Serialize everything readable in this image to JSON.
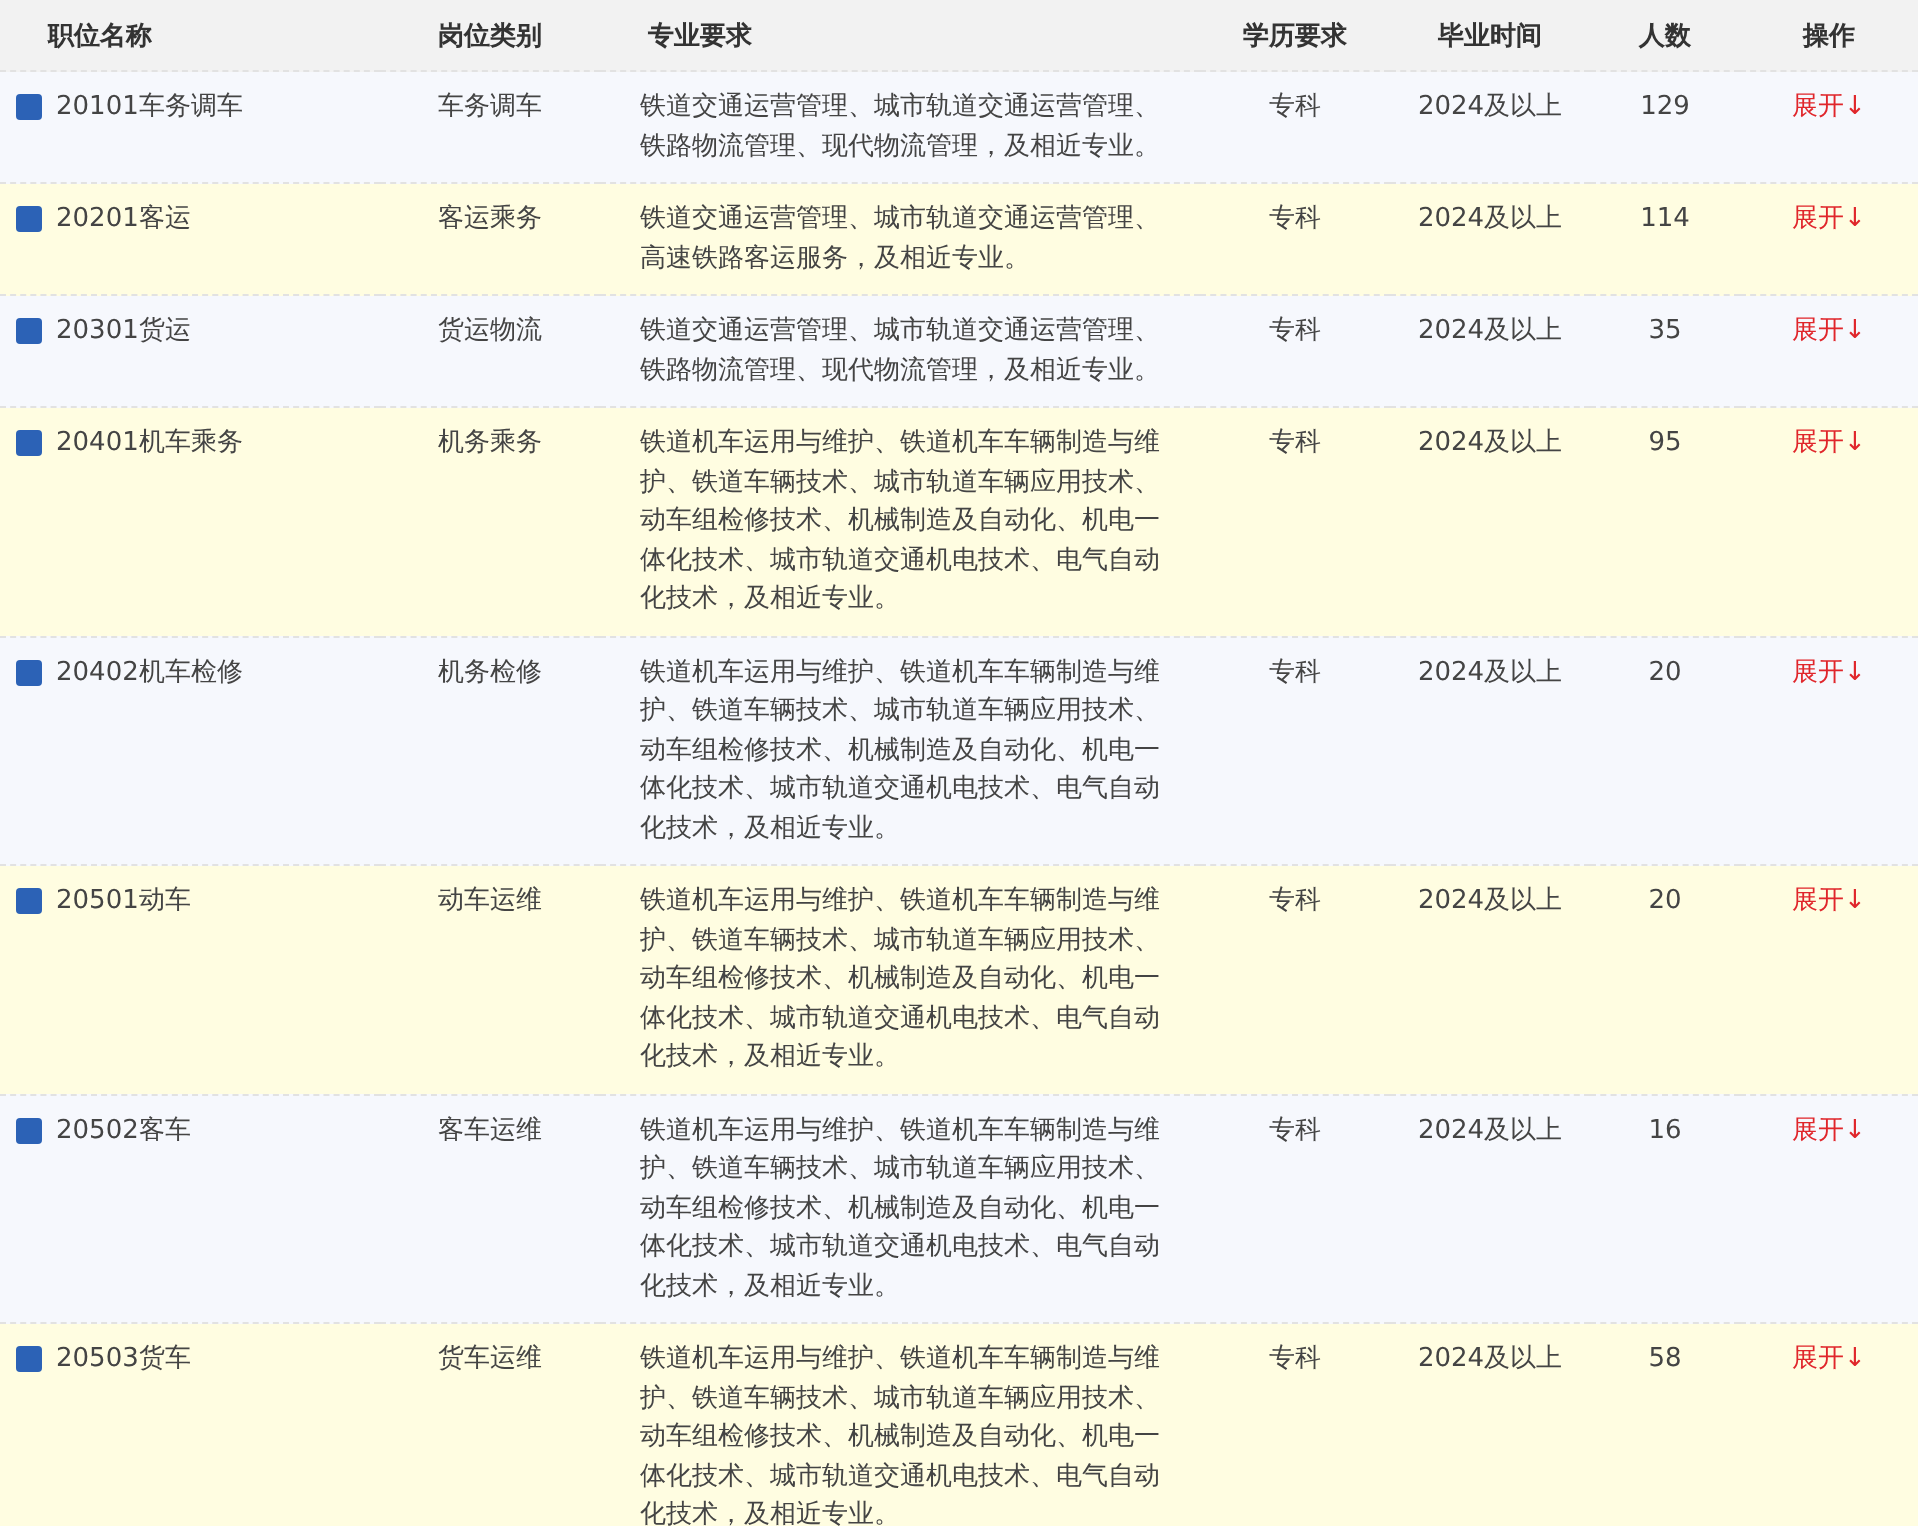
{
  "table": {
    "columns": [
      "职位名称",
      "岗位类别",
      "专业要求",
      "学历要求",
      "毕业时间",
      "人数",
      "操作"
    ],
    "rows": [
      {
        "name": "20101车务调车",
        "category": "车务调车",
        "major": "铁道交通运营管理、城市轨道交通运营管理、铁路物流管理、现代物流管理，及相近专业。",
        "education": "专科",
        "graduation": "2024及以上",
        "count": "129",
        "action": "展开↓"
      },
      {
        "name": "20201客运",
        "category": "客运乘务",
        "major": "铁道交通运营管理、城市轨道交通运营管理、高速铁路客运服务，及相近专业。",
        "education": "专科",
        "graduation": "2024及以上",
        "count": "114",
        "action": "展开↓"
      },
      {
        "name": "20301货运",
        "category": "货运物流",
        "major": "铁道交通运营管理、城市轨道交通运营管理、铁路物流管理、现代物流管理，及相近专业。",
        "education": "专科",
        "graduation": "2024及以上",
        "count": "35",
        "action": "展开↓"
      },
      {
        "name": "20401机车乘务",
        "category": "机务乘务",
        "major": "铁道机车运用与维护、铁道机车车辆制造与维护、铁道车辆技术、城市轨道车辆应用技术、动车组检修技术、机械制造及自动化、机电一体化技术、城市轨道交通机电技术、电气自动化技术，及相近专业。",
        "education": "专科",
        "graduation": "2024及以上",
        "count": "95",
        "action": "展开↓"
      },
      {
        "name": "20402机车检修",
        "category": "机务检修",
        "major": "铁道机车运用与维护、铁道机车车辆制造与维护、铁道车辆技术、城市轨道车辆应用技术、动车组检修技术、机械制造及自动化、机电一体化技术、城市轨道交通机电技术、电气自动化技术，及相近专业。",
        "education": "专科",
        "graduation": "2024及以上",
        "count": "20",
        "action": "展开↓"
      },
      {
        "name": "20501动车",
        "category": "动车运维",
        "major": "铁道机车运用与维护、铁道机车车辆制造与维护、铁道车辆技术、城市轨道车辆应用技术、动车组检修技术、机械制造及自动化、机电一体化技术、城市轨道交通机电技术、电气自动化技术，及相近专业。",
        "education": "专科",
        "graduation": "2024及以上",
        "count": "20",
        "action": "展开↓"
      },
      {
        "name": "20502客车",
        "category": "客车运维",
        "major": "铁道机车运用与维护、铁道机车车辆制造与维护、铁道车辆技术、城市轨道车辆应用技术、动车组检修技术、机械制造及自动化、机电一体化技术、城市轨道交通机电技术、电气自动化技术，及相近专业。",
        "education": "专科",
        "graduation": "2024及以上",
        "count": "16",
        "action": "展开↓"
      },
      {
        "name": "20503货车",
        "category": "货车运维",
        "major": "铁道机车运用与维护、铁道机车车辆制造与维护、铁道车辆技术、城市轨道车辆应用技术、动车组检修技术、机械制造及自动化、机电一体化技术、城市轨道交通机电技术、电气自动化技术，及相近专业。",
        "education": "专科",
        "graduation": "2024及以上",
        "count": "58",
        "action": "展开↓"
      }
    ]
  }
}
